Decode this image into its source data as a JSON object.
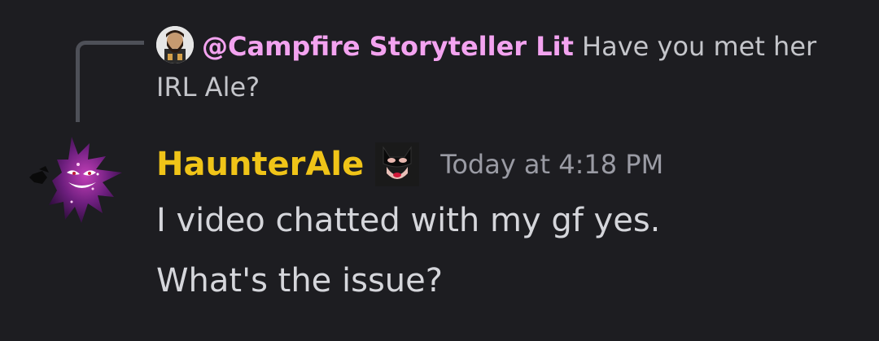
{
  "reply": {
    "mention": "@Campfire Storyteller Lit",
    "text": "Have you met her IRL Ale?",
    "avatar_icon": "bearded-man-avatar"
  },
  "message": {
    "author": "HaunterAle",
    "author_color": "#f0c418",
    "role_icon": "catwoman-mask-icon",
    "timestamp": "Today at 4:18 PM",
    "lines": [
      "I video chatted with my gf yes.",
      "What's the issue?"
    ],
    "avatar_icon": "haunter-ghost-avatar"
  },
  "colors": {
    "background": "#1d1d21",
    "mention": "#f3a3f0",
    "text": "#d5d6db",
    "muted": "#9a9ba4"
  }
}
